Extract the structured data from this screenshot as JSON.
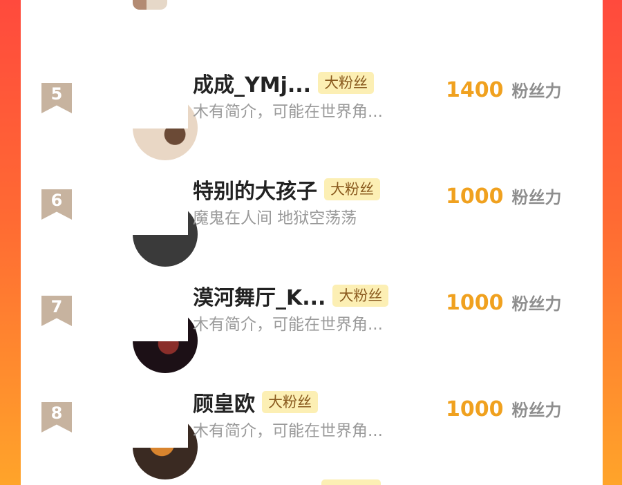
{
  "list": {
    "score_unit": "粉丝力",
    "items": [
      {
        "rank": "5",
        "name": "成成_YMj...",
        "badge": "大粉丝",
        "bio": "木有简介，可能在世界角...",
        "score": "1400",
        "avatar_colors": [
          "#e9d7c5",
          "#6b4a36"
        ]
      },
      {
        "rank": "6",
        "name": "特别的大孩子",
        "badge": "大粉丝",
        "bio": "魔鬼在人间 地狱空荡荡",
        "score": "1000",
        "avatar_colors": [
          "#3a3a3a",
          "#8c8c8c"
        ]
      },
      {
        "rank": "7",
        "name": "漠河舞厅_K...",
        "badge": "大粉丝",
        "bio": "木有简介，可能在世界角...",
        "score": "1000",
        "avatar_colors": [
          "#1c1016",
          "#8a2e2a"
        ]
      },
      {
        "rank": "8",
        "name": "顾皇欧",
        "badge": "大粉丝",
        "bio": "木有简介，可能在世界角...",
        "score": "1000",
        "avatar_colors": [
          "#d8842e",
          "#3a2a22"
        ]
      }
    ]
  }
}
